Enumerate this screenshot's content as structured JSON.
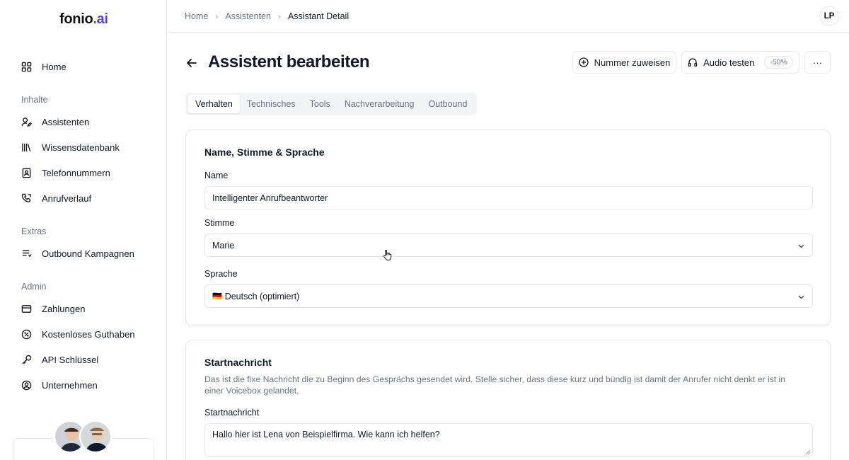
{
  "brand": {
    "name_main": "fonio",
    "name_dot": ".ai"
  },
  "sidebar": {
    "home": {
      "label": "Home",
      "icon": "grid-icon"
    },
    "sections": [
      {
        "label": "Inhalte"
      },
      {
        "label": "Extras"
      },
      {
        "label": "Admin"
      }
    ],
    "items": [
      {
        "label": "Assistenten",
        "icon": "user-edit-icon"
      },
      {
        "label": "Wissensdatenbank",
        "icon": "library-icon"
      },
      {
        "label": "Telefonnummern",
        "icon": "contact-book-icon"
      },
      {
        "label": "Anrufverlauf",
        "icon": "phone-history-icon"
      },
      {
        "label": "Outbound Kampagnen",
        "icon": "list-icon"
      },
      {
        "label": "Zahlungen",
        "icon": "credit-card-icon"
      },
      {
        "label": "Kostenloses Guthaben",
        "icon": "badge-percent-icon"
      },
      {
        "label": "API Schlüssel",
        "icon": "key-icon"
      },
      {
        "label": "Unternehmen",
        "icon": "user-circle-icon"
      }
    ]
  },
  "breadcrumb": [
    "Home",
    "Assistenten",
    "Assistant Detail"
  ],
  "user": {
    "initials": "LP"
  },
  "header": {
    "title": "Assistent bearbeiten",
    "assign_number": "Nummer zuweisen",
    "test_audio": "Audio testen",
    "test_audio_badge": "-50%",
    "more": "···"
  },
  "tabs": [
    "Verhalten",
    "Technisches",
    "Tools",
    "Nachverarbeitung",
    "Outbound"
  ],
  "card1": {
    "title": "Name, Stimme & Sprache",
    "name_label": "Name",
    "name_value": "Intelligenter Anrufbeantworter",
    "voice_label": "Stimme",
    "voice_value": "Marie",
    "language_label": "Sprache",
    "language_flag": "🇩🇪",
    "language_value": "Deutsch (optimiert)"
  },
  "card2": {
    "title": "Startnachricht",
    "description": "Das ist die fixe Nachricht die zu Beginn des Gesprächs gesendet wird. Stelle sicher, dass diese kurz und bündig ist damit der Anrufer nicht denkt er ist in einer Voicebox gelandet.",
    "field_label": "Startnachricht",
    "field_value": "Hallo hier ist Lena von Beispielfirma. Wie kann ich helfen?"
  },
  "colors": {
    "accent": "#4f46e5",
    "border": "#e5e7eb",
    "muted": "#6b7280"
  }
}
